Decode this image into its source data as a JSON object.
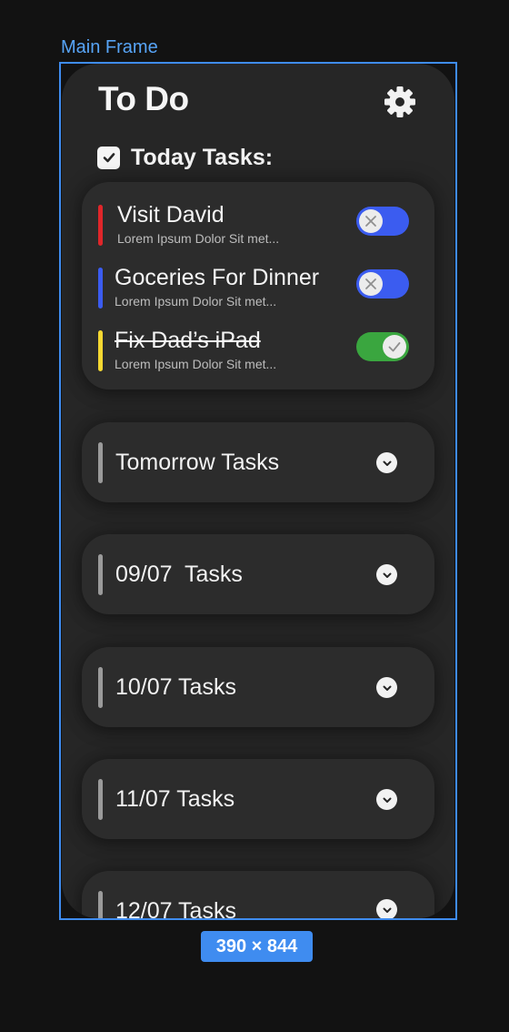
{
  "canvas": {
    "frame_label": "Main Frame",
    "size_badge": "390 × 844"
  },
  "app": {
    "title": "To Do",
    "settings_icon": "gear-icon"
  },
  "today": {
    "label": "Today Tasks:",
    "checked": true,
    "tasks": [
      {
        "title": "Visit David",
        "subtitle": "Lorem Ipsum Dolor Sit met...",
        "color": "#e0262a",
        "done": false,
        "toggle_color": "#3b5cf0"
      },
      {
        "title": "Goceries For Dinner",
        "subtitle": "Lorem Ipsum Dolor Sit met...",
        "color": "#3b5cf0",
        "done": false,
        "toggle_color": "#3b5cf0"
      },
      {
        "title": "Fix Dad’s iPad",
        "subtitle": "Lorem Ipsum Dolor Sit met...",
        "color": "#f5d832",
        "done": true,
        "toggle_color": "#3aa63f"
      }
    ]
  },
  "groups": [
    {
      "label": "Tomorrow Tasks"
    },
    {
      "label": "09/07  Tasks"
    },
    {
      "label": "10/07 Tasks"
    },
    {
      "label": "11/07 Tasks"
    },
    {
      "label": "12/07 Tasks"
    }
  ]
}
